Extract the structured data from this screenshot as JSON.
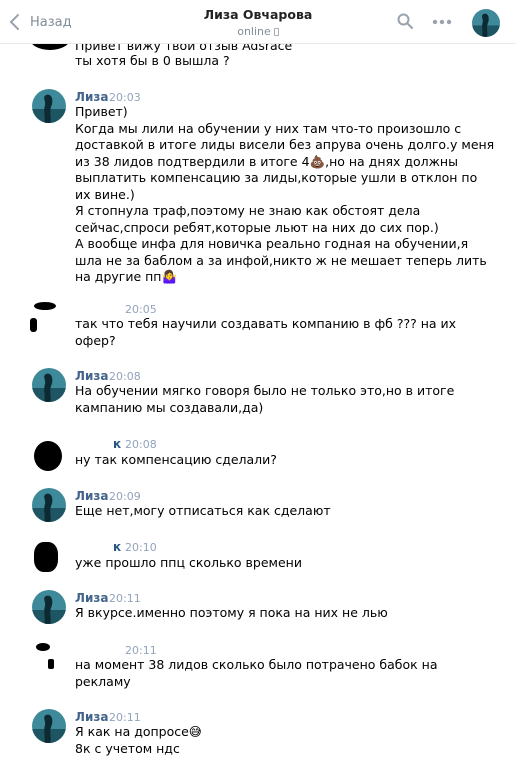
{
  "header": {
    "back_label": "Назад",
    "contact_name": "Лиза Овчарова",
    "status": "online"
  },
  "feed": {
    "top_cut_lines": [
      "Привет вижу твой отзыв Adsrace",
      "ты хотя бы в 0 вышла ?"
    ],
    "messages": [
      {
        "author": "Лиза",
        "time": "20:03",
        "lines": [
          "Привет)",
          "Когда мы лили на обучении у них там что-то произошло с",
          "доставкой в итоге лиды висели без апрува очень долго.у меня",
          "из 38 лидов подтвердили в итоге 4💩,но на днях должны",
          "выплатить компенсацию за лиды,которые ушли в отклон по",
          "их вине.)",
          "Я стопнула траф,поэтому не знаю как обстоят дела",
          "сейчас,спроси ребят,которые льют на них до сих пор.)",
          "А вообще инфа для новичка реально годная на обучении,я",
          "шла не за баблом а за инфой,никто ж не мешает теперь лить",
          "на другие пп🤷‍♀️"
        ]
      },
      {
        "author": "",
        "time": "20:05",
        "lines": [
          "так что тебя научили создавать компанию в фб ??? на их",
          "офер?"
        ]
      },
      {
        "author": "Лиза",
        "time": "20:08",
        "lines": [
          "На обучении мягко говоря было не только это,но в итоге",
          "кампанию мы создавали,да)"
        ]
      },
      {
        "author": "к",
        "time": "20:08",
        "lines": [
          "ну так компенсацию сделали?"
        ]
      },
      {
        "author": "Лиза",
        "time": "20:09",
        "lines": [
          "Еще нет,могу отписаться как сделают"
        ]
      },
      {
        "author": "к",
        "time": "20:10",
        "lines": [
          "уже прошло ппц сколько времени"
        ]
      },
      {
        "author": "Лиза",
        "time": "20:11",
        "lines": [
          "Я вкурсе.именно поэтому я пока на них не лью"
        ]
      },
      {
        "author": "",
        "time": "20:11",
        "lines": [
          "на момент 38 лидов сколько было потрачено бабок на",
          "рекламу"
        ]
      },
      {
        "author": "Лиза",
        "time": "20:11",
        "lines": [
          "Я как на допросе😅",
          "8к с учетом ндс"
        ]
      }
    ]
  },
  "colors": {
    "link": "#42648b",
    "muted": "#818c99",
    "time": "#93a3bc"
  }
}
